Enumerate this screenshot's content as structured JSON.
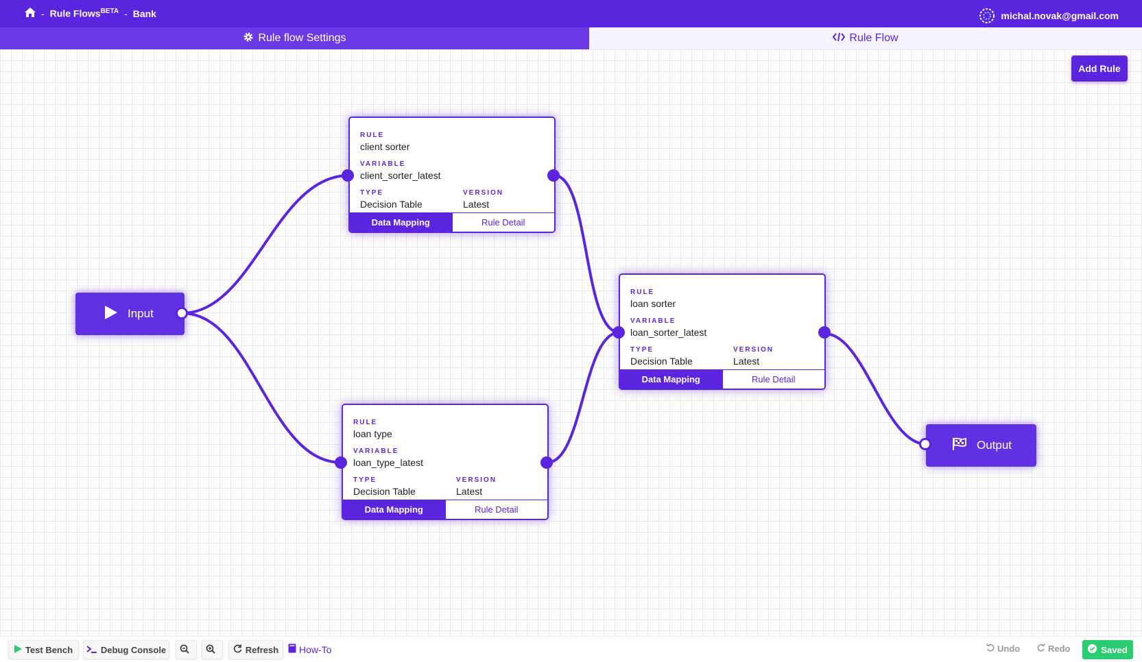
{
  "header": {
    "home_icon": "home-icon",
    "sep1": "-",
    "app_name": "Rule Flows",
    "app_badge": "BETA",
    "sep2": "-",
    "project": "Bank",
    "user_email": "michal.novak@gmail.com",
    "avatar_icon": "avatar-icon"
  },
  "tabs": {
    "settings": {
      "label": "Rule flow Settings",
      "icon": "gear-icon"
    },
    "flow": {
      "label": "Rule Flow",
      "icon": "code-icon"
    }
  },
  "toolbar": {
    "add_rule": "Add Rule"
  },
  "nodes": {
    "input": {
      "label": "Input",
      "icon": "play-icon"
    },
    "output": {
      "label": "Output",
      "icon": "checkered-flag-icon"
    },
    "rules": [
      {
        "rule_label": "RULE",
        "rule": "client sorter",
        "variable_label": "VARIABLE",
        "variable": "client_sorter_latest",
        "type_label": "TYPE",
        "type": "Decision Table",
        "version_label": "VERSION",
        "version": "Latest",
        "mapping_btn": "Data Mapping",
        "detail_btn": "Rule Detail"
      },
      {
        "rule_label": "RULE",
        "rule": "loan type",
        "variable_label": "VARIABLE",
        "variable": "loan_type_latest",
        "type_label": "TYPE",
        "type": "Decision Table",
        "version_label": "VERSION",
        "version": "Latest",
        "mapping_btn": "Data Mapping",
        "detail_btn": "Rule Detail"
      },
      {
        "rule_label": "RULE",
        "rule": "loan sorter",
        "variable_label": "VARIABLE",
        "variable": "loan_sorter_latest",
        "type_label": "TYPE",
        "type": "Decision Table",
        "version_label": "VERSION",
        "version": "Latest",
        "mapping_btn": "Data Mapping",
        "detail_btn": "Rule Detail"
      }
    ]
  },
  "footer": {
    "test_bench": "Test Bench",
    "debug_console": "Debug Console",
    "zoom_out_icon": "zoom-out-icon",
    "zoom_in_icon": "zoom-in-icon",
    "refresh": "Refresh",
    "howto": "How-To",
    "undo": "Undo",
    "redo": "Redo",
    "saved": "Saved"
  },
  "colors": {
    "accent": "#5b25e0",
    "success": "#2ecc71"
  }
}
